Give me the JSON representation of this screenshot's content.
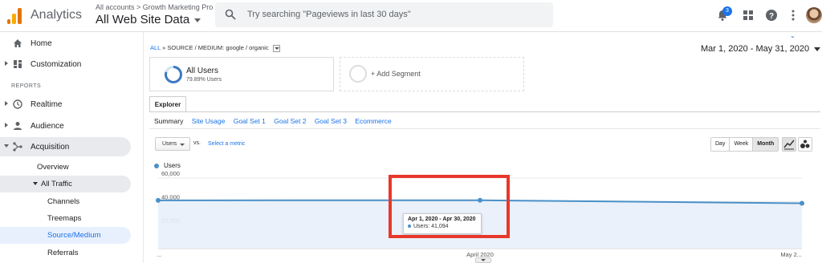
{
  "topbar": {
    "app_name": "Analytics",
    "breadcrumb": "All accounts > Growth Marketing Pro",
    "account": "All Web Site Data",
    "search_placeholder": "Try searching \"Pageviews in last 30 days\"",
    "notification_count": "3",
    "icons": [
      "notifications-icon",
      "apps-grid-icon",
      "help-icon",
      "more-vert-icon",
      "avatar"
    ]
  },
  "sidebar": {
    "items_top": [
      {
        "label": "Home",
        "icon": "home-icon"
      },
      {
        "label": "Customization",
        "icon": "dashboard-icon"
      }
    ],
    "reports_header": "REPORTS",
    "items_reports": [
      {
        "label": "Realtime",
        "icon": "clock-icon"
      },
      {
        "label": "Audience",
        "icon": "person-icon"
      },
      {
        "label": "Acquisition",
        "icon": "acquisition-icon"
      }
    ],
    "acquisition_sub": [
      {
        "label": "Overview"
      },
      {
        "label": "All Traffic"
      },
      {
        "label": "Channels"
      },
      {
        "label": "Treemaps"
      },
      {
        "label": "Source/Medium"
      },
      {
        "label": "Referrals"
      }
    ]
  },
  "main": {
    "crumb_all": "ALL",
    "crumb_rest": "» SOURCE / MEDIUM: google / organic",
    "date_range": "Mar 1, 2020 - May 31, 2020",
    "segment_title": "All Users",
    "segment_sub": "79.89% Users",
    "add_segment": "+ Add Segment",
    "explorer_tab": "Explorer",
    "subtabs": [
      "Summary",
      "Site Usage",
      "Goal Set 1",
      "Goal Set 2",
      "Goal Set 3",
      "Ecommerce"
    ],
    "metric_select": "Users",
    "vs": "vs.",
    "select_metric": "Select a metric",
    "periods": [
      "Day",
      "Week",
      "Month"
    ],
    "active_period": "Month",
    "tooltip_date": "Apr 1, 2020 - Apr 30, 2020",
    "tooltip_value": "Users: 41,094"
  },
  "chart_data": {
    "type": "line",
    "series": [
      {
        "name": "Users",
        "values": [
          41000,
          41094,
          38500
        ]
      }
    ],
    "categories": [
      "...",
      "April 2020",
      "May 2..."
    ],
    "yticks": [
      "60,000",
      "40,000",
      "20,000"
    ],
    "ylim": [
      0,
      60000
    ],
    "grid": true,
    "colors": {
      "line": "#4a90c8",
      "fill": "#e8f0fa"
    }
  }
}
